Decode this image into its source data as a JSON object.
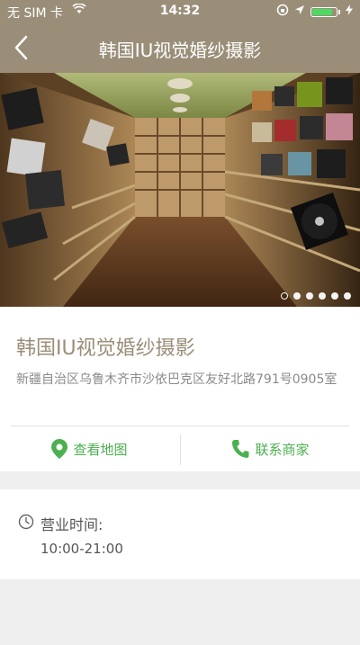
{
  "status_bar": {
    "carrier": "无 SIM 卡",
    "time": "14:32",
    "battery_level": 0.9,
    "icons": [
      "wifi-icon",
      "rotation-lock-icon",
      "location-icon",
      "battery-icon",
      "charging-icon"
    ]
  },
  "nav": {
    "title": "韩国IU视觉婚纱摄影",
    "back_icon": "chevron-left-icon"
  },
  "gallery": {
    "slide_count": 6,
    "active_index": 0
  },
  "shop": {
    "name": "韩国IU视觉婚纱摄影",
    "address": "新疆自治区乌鲁木齐市沙依巴克区友好北路791号0905室"
  },
  "actions": {
    "map_label": "查看地图",
    "call_label": "联系商家"
  },
  "hours": {
    "label": "营业时间:",
    "value": "10:00-21:00"
  },
  "colors": {
    "bar": "#9a8e78",
    "accent_green": "#4cb050",
    "title_text": "#9a8e78"
  }
}
